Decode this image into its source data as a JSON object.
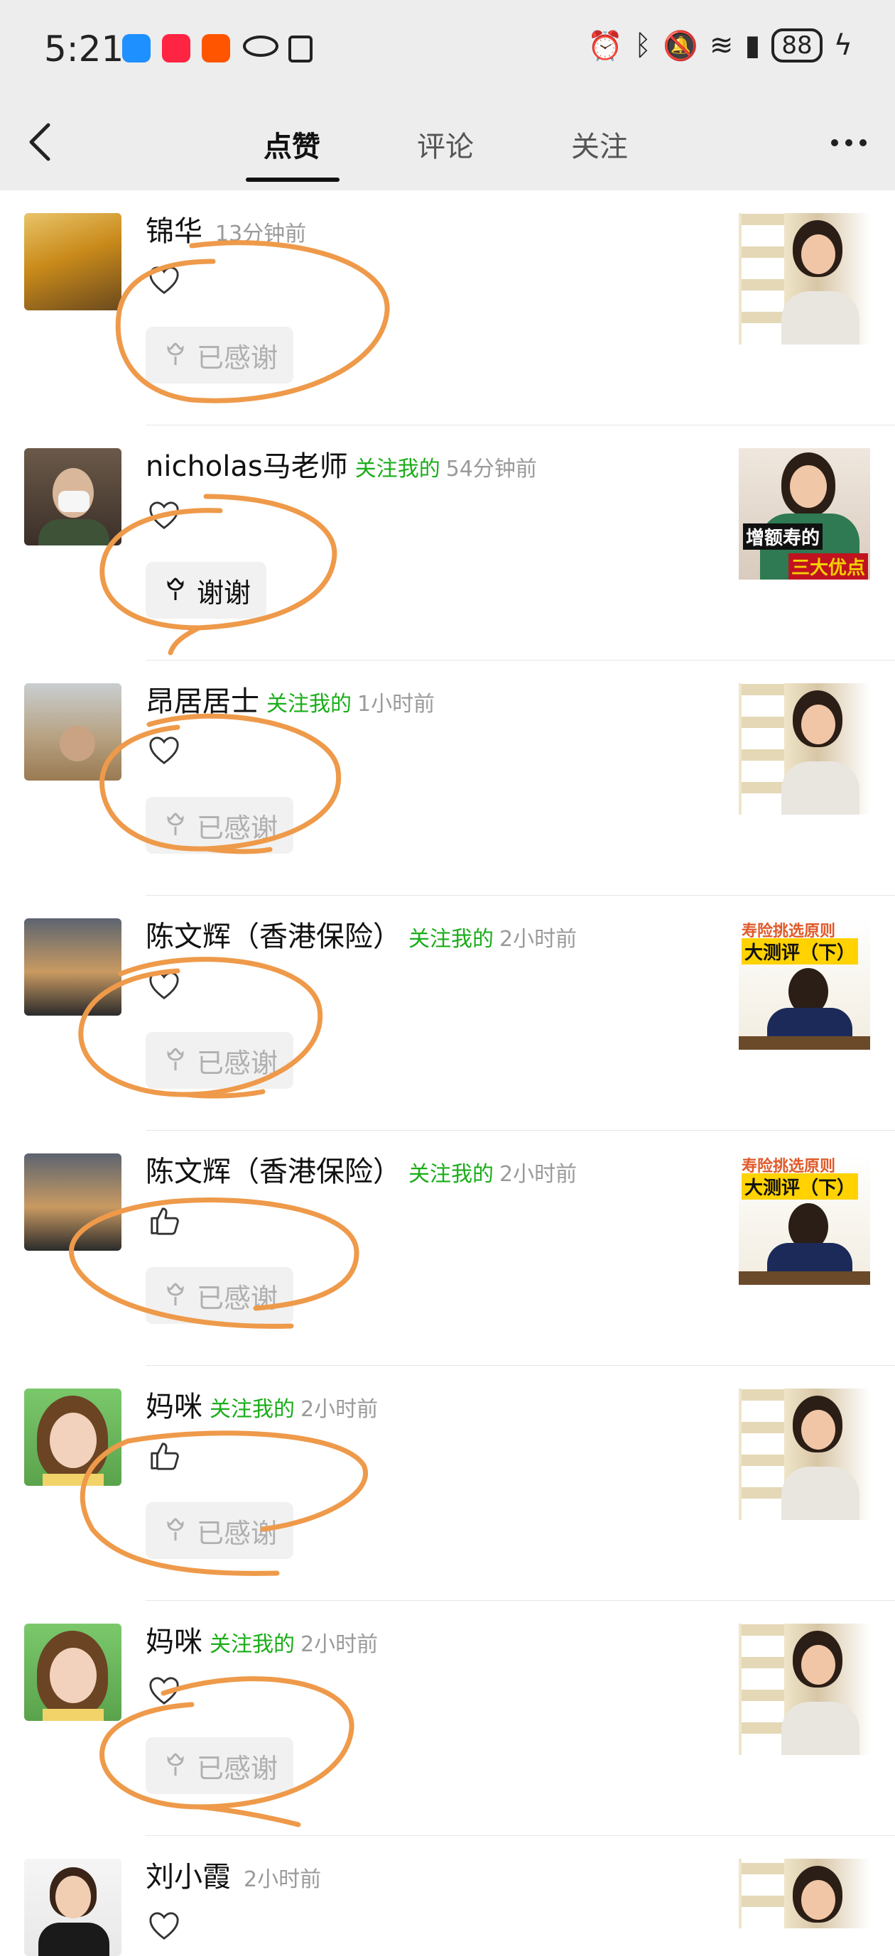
{
  "status_bar": {
    "time": "5:21",
    "battery": "88",
    "icons": [
      "chat-app-icon",
      "xiaohongshu-icon",
      "taobao-icon",
      "eye-icon",
      "nfc-icon",
      "alarm-icon",
      "bluetooth-icon",
      "mute-icon",
      "wifi-icon",
      "signal-icon",
      "battery-icon",
      "charging-icon"
    ]
  },
  "nav": {
    "tabs": [
      {
        "label": "点赞",
        "active": true
      },
      {
        "label": "评论",
        "active": false
      },
      {
        "label": "关注",
        "active": false
      }
    ]
  },
  "rows": [
    {
      "name": "锦华",
      "follow": "",
      "time": "13分钟前",
      "like": "heart",
      "thanks": "已感谢",
      "thanks_active": false
    },
    {
      "name": "nicholas马老师",
      "follow": "关注我的",
      "time": "54分钟前",
      "like": "heart",
      "thanks": "谢谢",
      "thanks_active": true
    },
    {
      "name": "昂居居士",
      "follow": "关注我的",
      "time": "1小时前",
      "like": "heart",
      "thanks": "已感谢",
      "thanks_active": false
    },
    {
      "name": "陈文辉（香港保险）",
      "follow": "关注我的",
      "time": "2小时前",
      "like": "heart",
      "thanks": "已感谢",
      "thanks_active": false
    },
    {
      "name": "陈文辉（香港保险）",
      "follow": "关注我的",
      "time": "2小时前",
      "like": "thumb",
      "thanks": "已感谢",
      "thanks_active": false
    },
    {
      "name": "妈咪",
      "follow": "关注我的",
      "time": "2小时前",
      "like": "thumb",
      "thanks": "已感谢",
      "thanks_active": false
    },
    {
      "name": "妈咪",
      "follow": "关注我的",
      "time": "2小时前",
      "like": "heart",
      "thanks": "已感谢",
      "thanks_active": false
    },
    {
      "name": "刘小霞",
      "follow": "",
      "time": "2小时前",
      "like": "heart",
      "thanks": "",
      "thanks_active": false
    }
  ],
  "thumb_texts": {
    "t2_a": "增额寿的",
    "t2_b": "三大优点",
    "t4_a": "寿险挑选原则",
    "t4_b": "大测评（下）"
  },
  "colors": {
    "follow_green": "#1aad19",
    "annotation_orange": "#ee9a4a"
  }
}
